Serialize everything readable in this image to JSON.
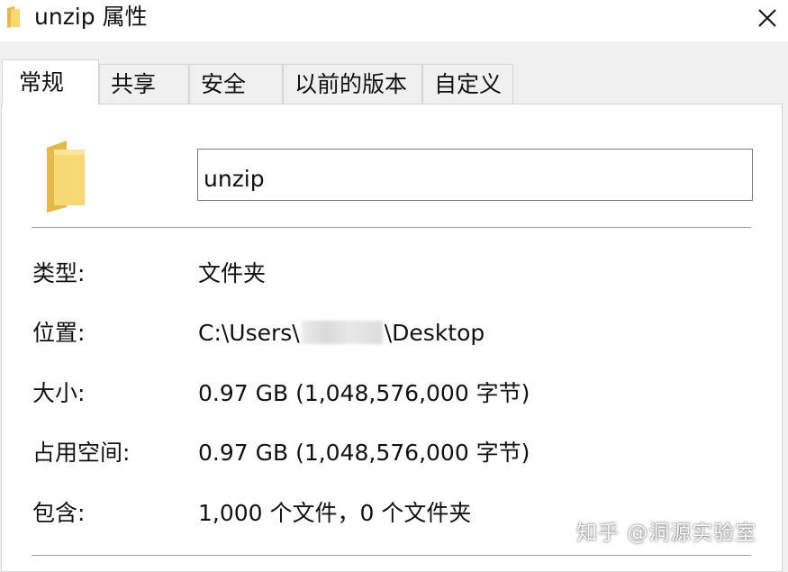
{
  "window": {
    "title": "unzip 属性",
    "icon": "folder-icon",
    "close_icon": "close-icon"
  },
  "tabs": [
    {
      "label": "常规",
      "active": true
    },
    {
      "label": "共享",
      "active": false
    },
    {
      "label": "安全",
      "active": false
    },
    {
      "label": "以前的版本",
      "active": false
    },
    {
      "label": "自定义",
      "active": false
    }
  ],
  "general": {
    "name_value": "unzip",
    "rows": [
      {
        "label": "类型:",
        "value": "文件夹"
      },
      {
        "label": "位置:",
        "value_prefix": "C:\\Users\\",
        "value_suffix": "\\Desktop"
      },
      {
        "label": "大小:",
        "value": "0.97 GB (1,048,576,000 字节)"
      },
      {
        "label": "占用空间:",
        "value": "0.97 GB (1,048,576,000 字节)"
      },
      {
        "label": "包含:",
        "value": "1,000 个文件，0 个文件夹"
      }
    ]
  },
  "watermark": "知乎 @洞源实验室",
  "colors": {
    "folder_yellow": "#f8d775",
    "folder_dark": "#e4b84a",
    "window_bg": "#f0f0f0",
    "panel_bg": "#ffffff"
  }
}
